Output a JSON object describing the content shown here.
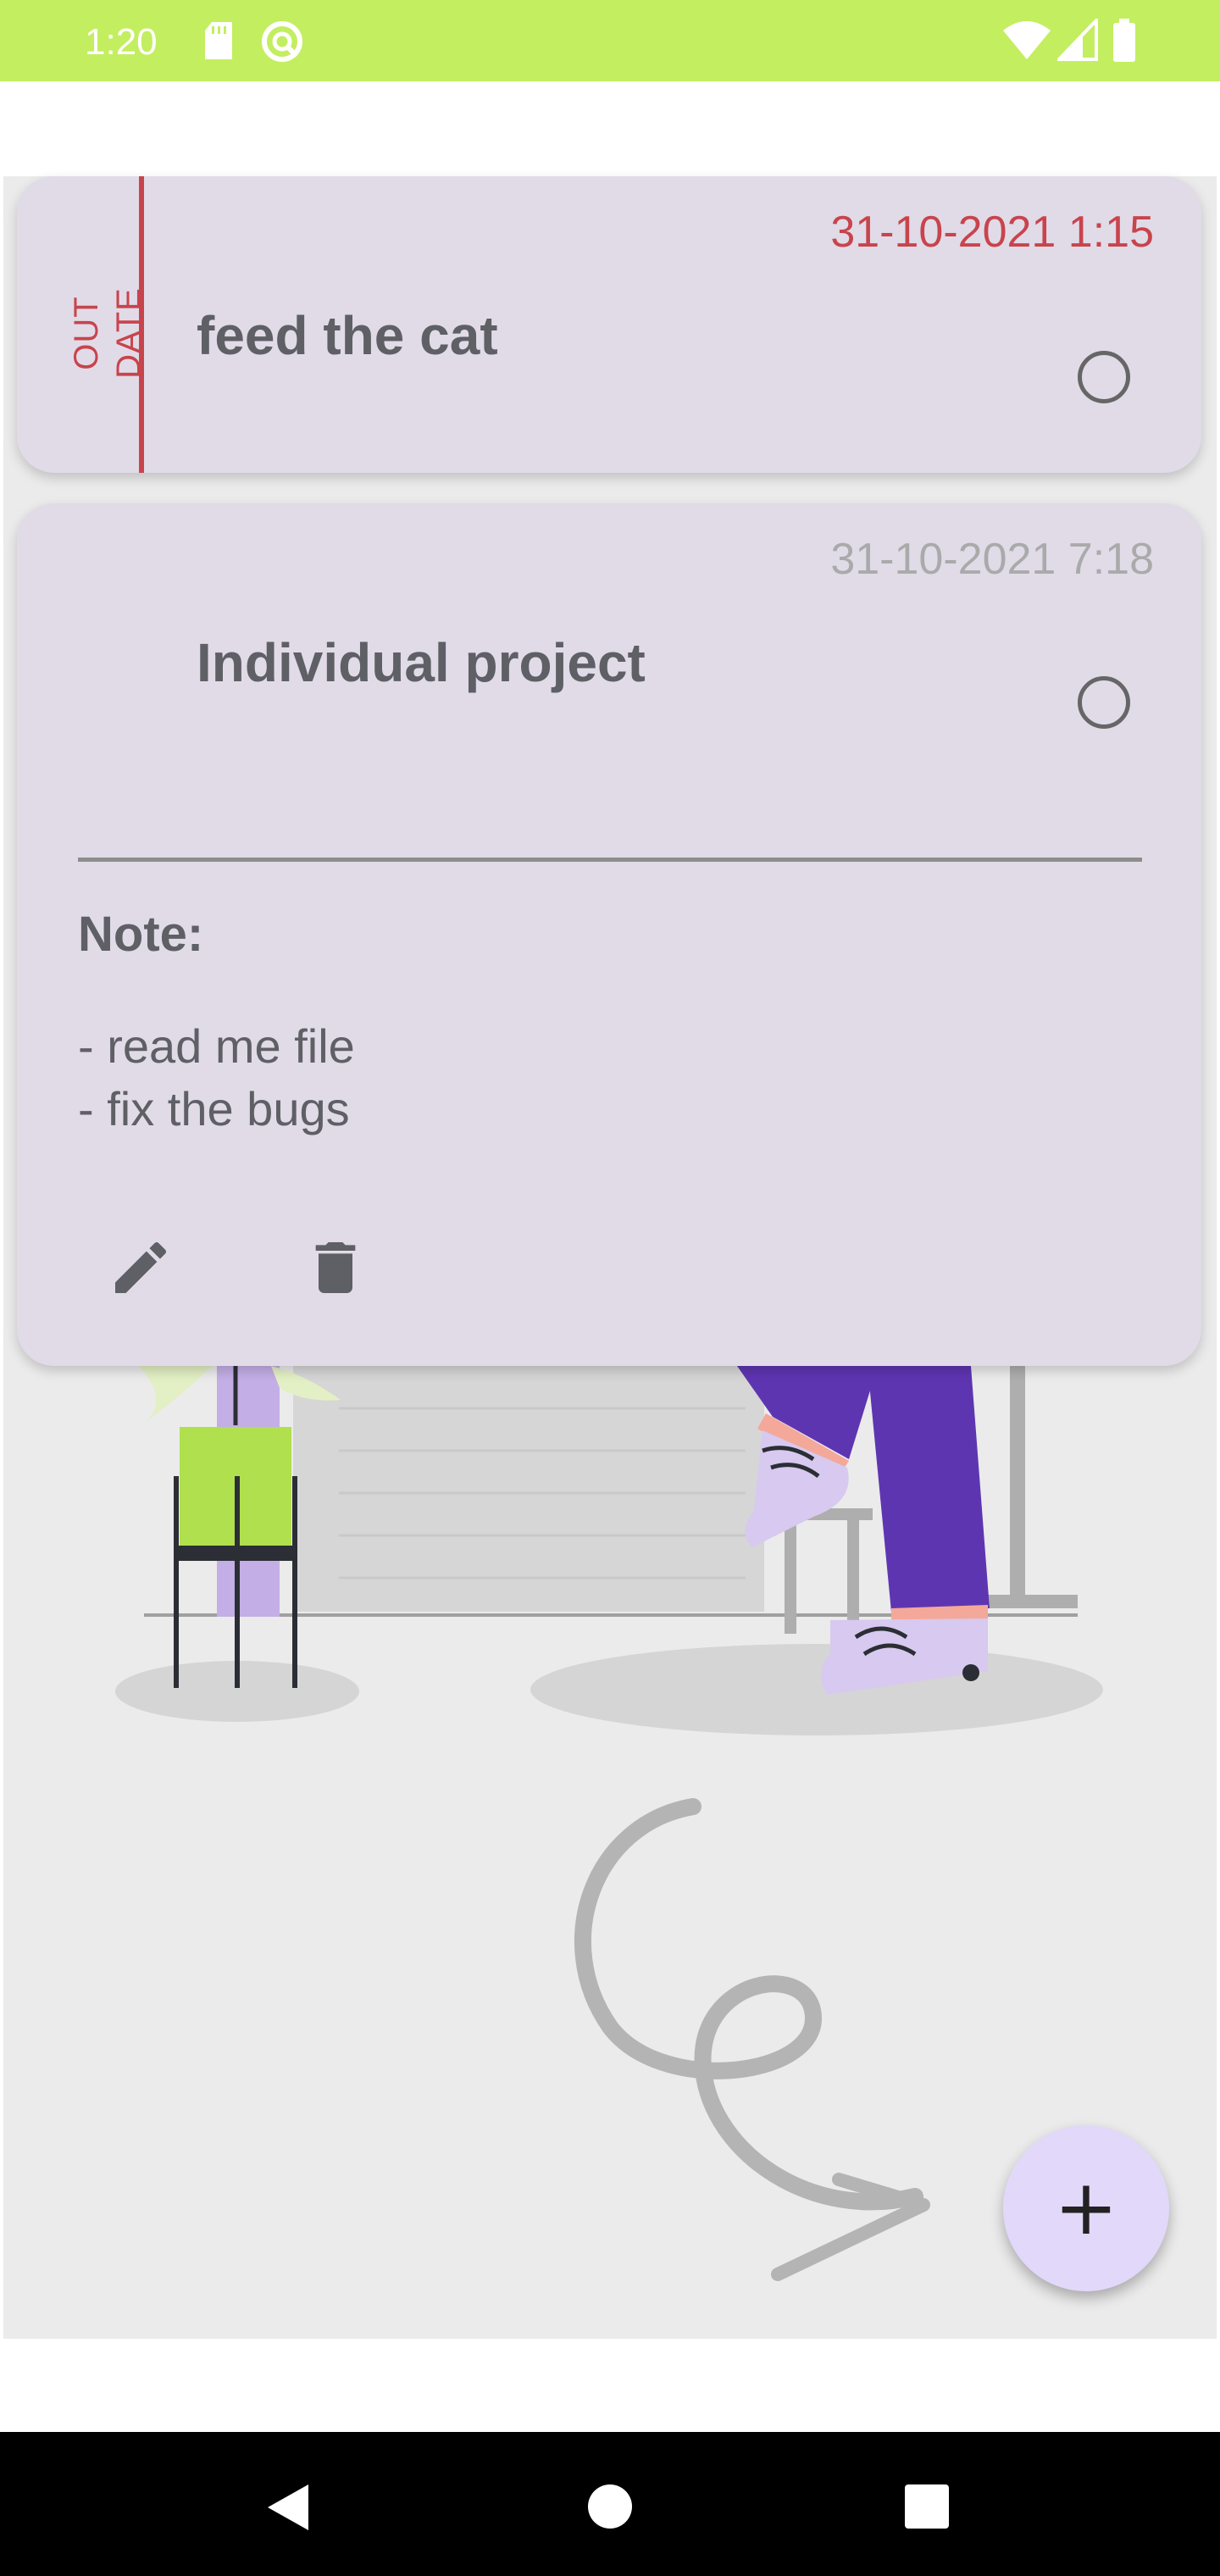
{
  "status_bar": {
    "time": "1:20",
    "icons": [
      "sd-card-icon",
      "sync-icon",
      "wifi-icon",
      "signal-icon",
      "battery-icon"
    ],
    "color": "#c3ee60"
  },
  "tasks": [
    {
      "status_label": "OUT DATE",
      "date": "31-10-2021 1:15",
      "title": "feed the cat",
      "overdue": true
    },
    {
      "date": "31-10-2021 7:18",
      "title": "Individual project",
      "note_label": "Note:",
      "note_text": "- read me file\n- fix the bugs",
      "actions": [
        "edit-icon",
        "delete-icon"
      ],
      "expanded": true
    }
  ],
  "fab": {
    "icon": "plus-icon",
    "symbol": "+"
  },
  "colors": {
    "card": "#e1dbe8",
    "overdue": "#c8444c",
    "fab": "#e2d8fa",
    "accent_purple": "#5e35b1",
    "accent_green": "#b0e04e"
  },
  "nav": [
    "back-icon",
    "home-icon",
    "recents-icon"
  ]
}
